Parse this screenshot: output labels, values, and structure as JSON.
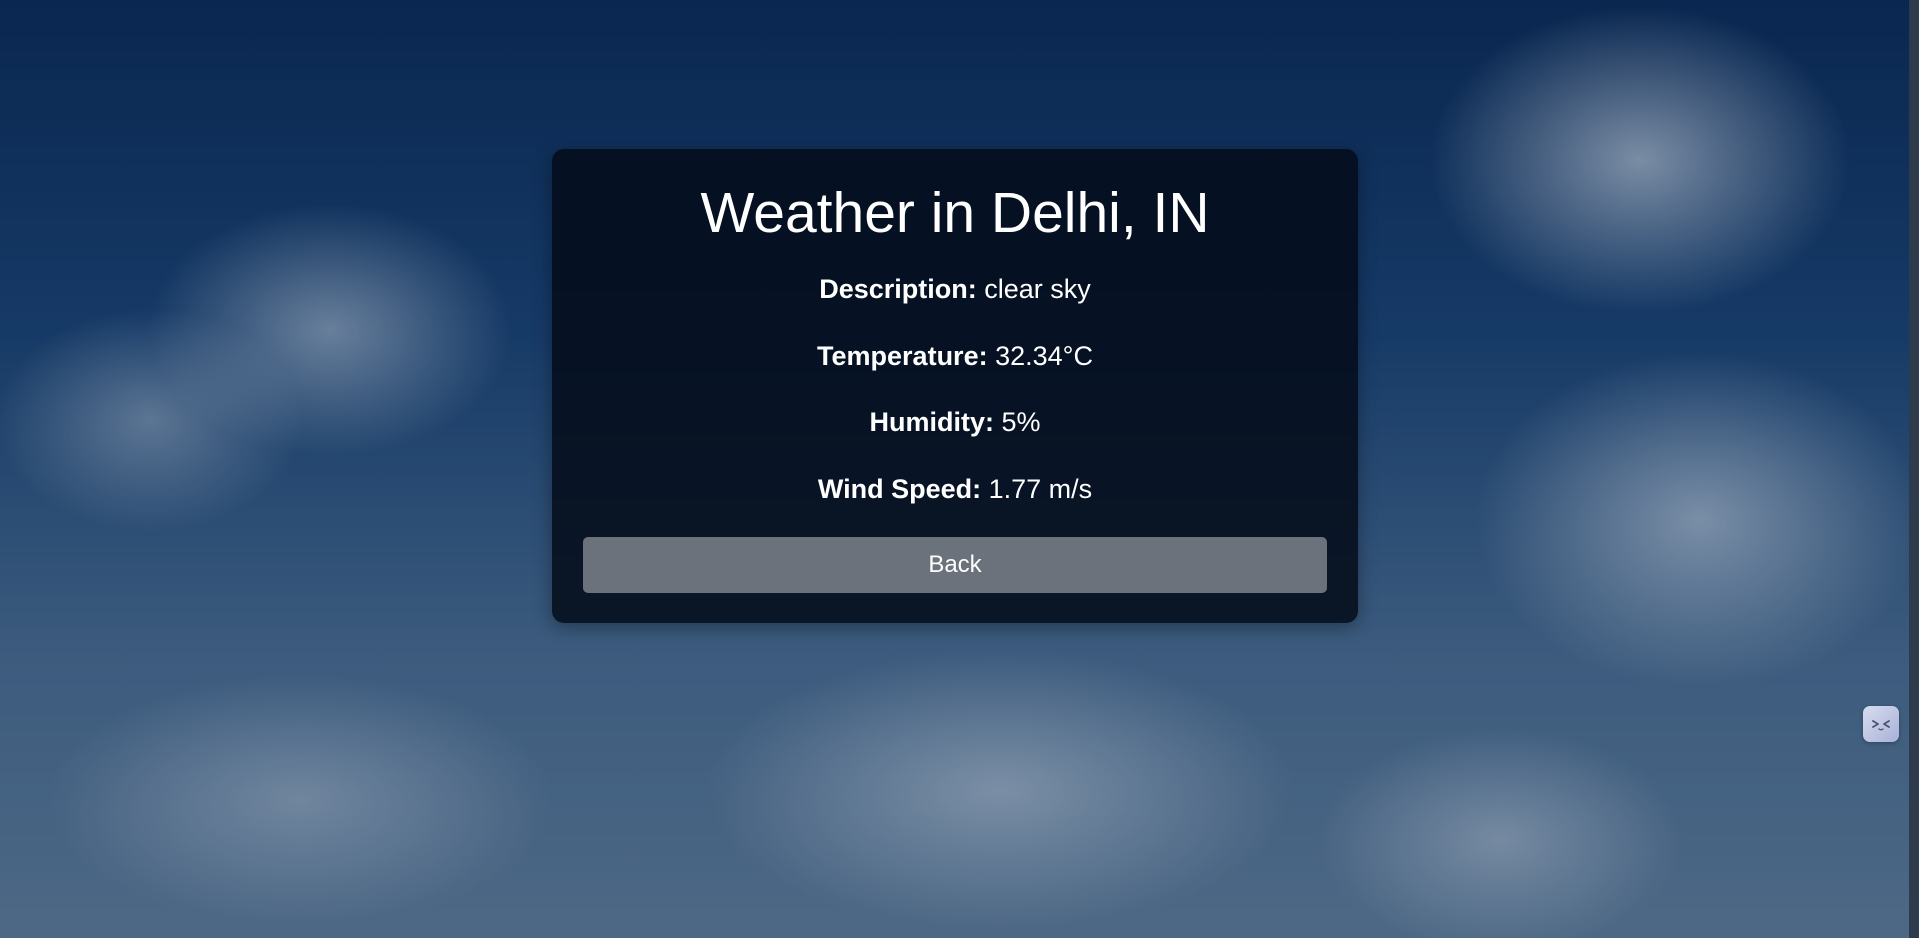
{
  "weather": {
    "title": "Weather in Delhi, IN",
    "rows": [
      {
        "label": "Description:",
        "value": "clear sky"
      },
      {
        "label": "Temperature:",
        "value": "32.34°C"
      },
      {
        "label": "Humidity:",
        "value": "5%"
      },
      {
        "label": "Wind Speed:",
        "value": "1.77 m/s"
      }
    ],
    "back_label": "Back"
  },
  "widget": {
    "icon": "face-icon"
  },
  "colors": {
    "card_background": "#040c18",
    "button_background": "#6b727b",
    "text": "#ffffff",
    "sky_top": "#0c2b57"
  }
}
